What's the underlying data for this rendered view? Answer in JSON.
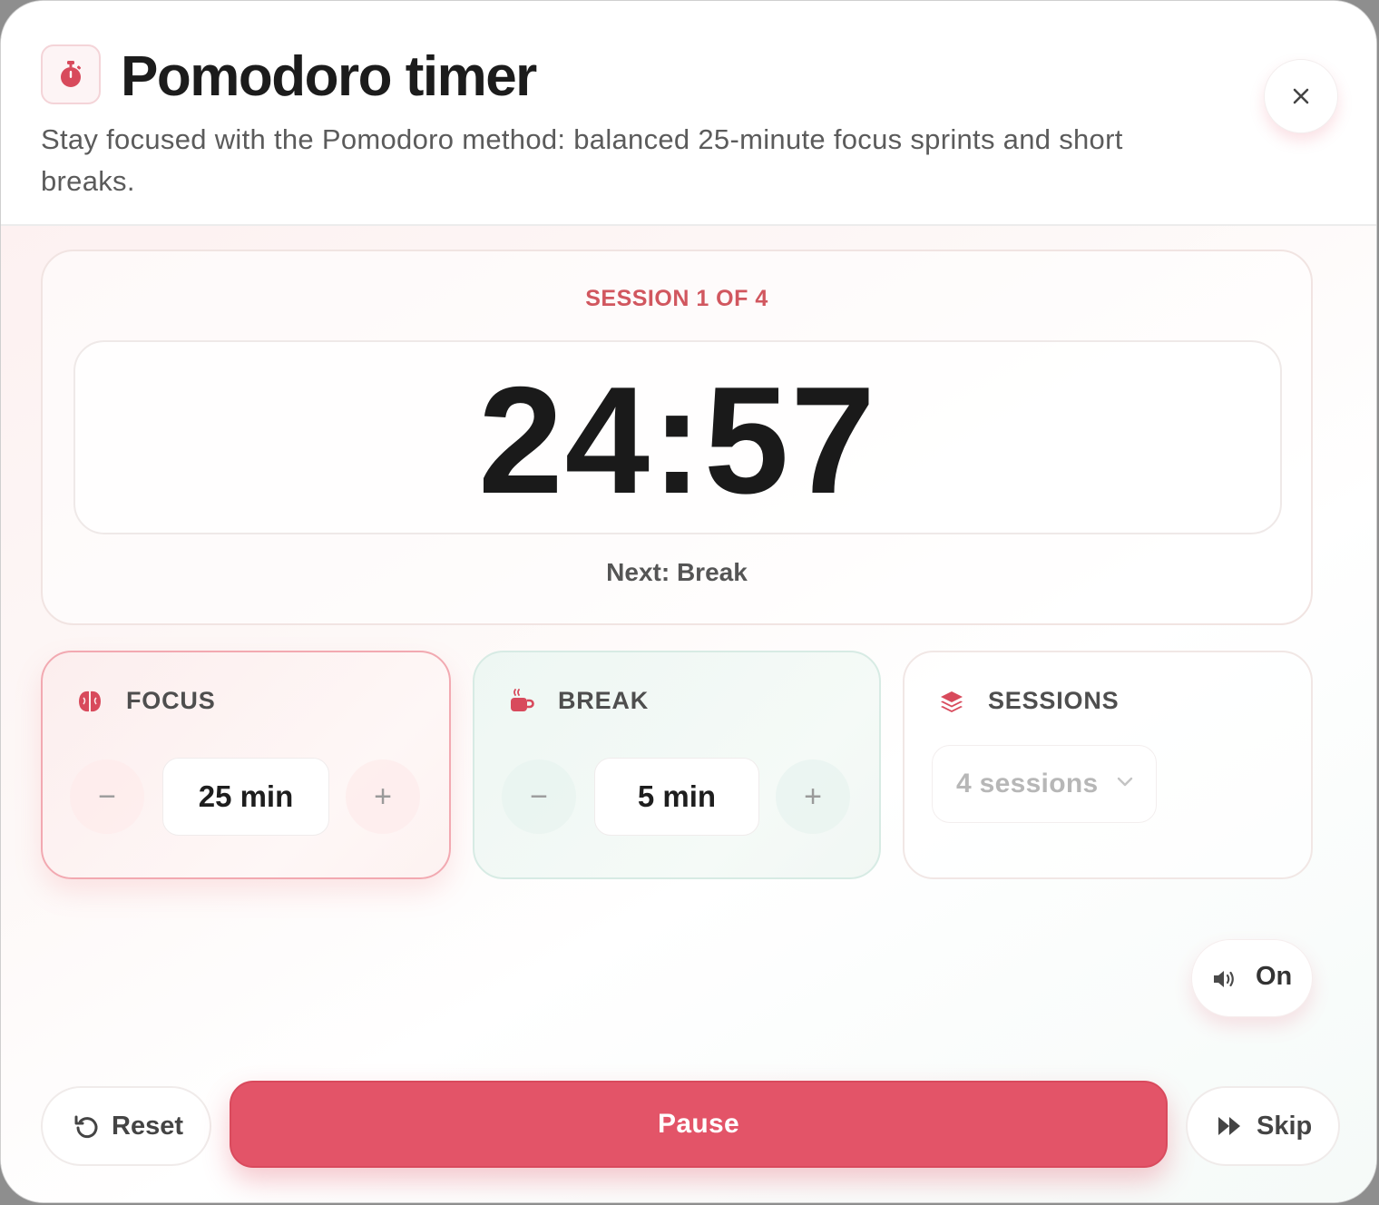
{
  "header": {
    "title": "Pomodoro timer",
    "subtitle": "Stay focused with the Pomodoro method: balanced 25-minute focus sprints and short breaks.",
    "icon": "stopwatch-icon",
    "close_icon": "close-icon"
  },
  "timer": {
    "session_label": "SESSION 1 OF 4",
    "time": "24:57",
    "next_label": "Next: Break"
  },
  "focus": {
    "title": "FOCUS",
    "icon": "brain-icon",
    "decrement": "−",
    "value": "25 min",
    "increment": "+"
  },
  "break": {
    "title": "BREAK",
    "icon": "coffee-icon",
    "decrement": "−",
    "value": "5 min",
    "increment": "+"
  },
  "sessions": {
    "title": "SESSIONS",
    "icon": "layers-icon",
    "selected": "4 sessions"
  },
  "sound": {
    "icon": "speaker-icon",
    "label": "On"
  },
  "controls": {
    "reset_label": "Reset",
    "pause_label": "Pause",
    "skip_label": "Skip"
  },
  "colors": {
    "accent": "#e35468",
    "focus_border": "#f2a9b1",
    "break_border": "#d7ebe4",
    "session_label": "#d1575f"
  }
}
